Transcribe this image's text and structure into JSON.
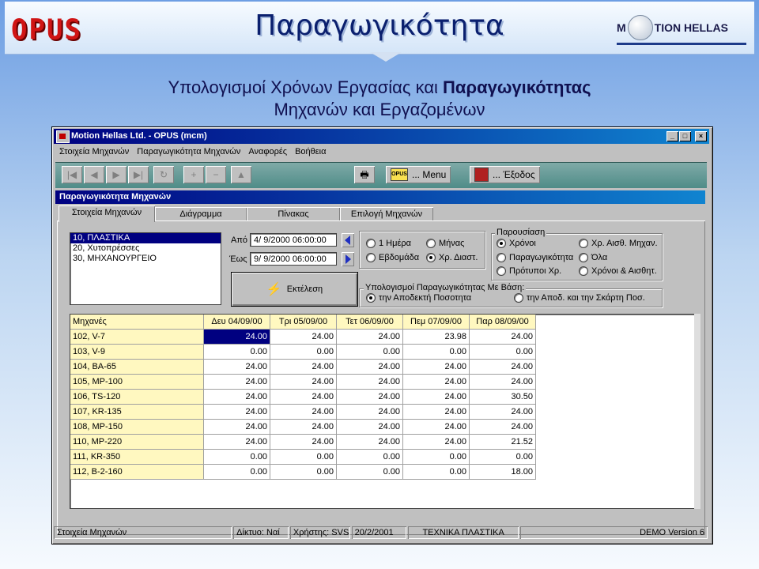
{
  "slide": {
    "logo_left": "OPUS",
    "title": "Παραγωγικότητα",
    "logo_right_a": "M",
    "logo_right_b": "TION HELLAS",
    "subtitle_line1_a": "Υπολογισμοί Χρόνων Εργασίας και ",
    "subtitle_line1_b": "Παραγωγικότητας",
    "subtitle_line2": "Μηχανών και Εργαζομένων"
  },
  "window": {
    "title": "Motion Hellas Ltd. - OPUS (mcm)",
    "controls": [
      "_",
      "□",
      "×"
    ],
    "menu": [
      "Στοιχεία Μηχανών",
      "Παραγωγικότητα Μηχανών",
      "Αναφορές",
      "Βοήθεια"
    ],
    "toolbar": {
      "nav_icons": [
        "first-icon",
        "prev-icon",
        "next-icon",
        "last-icon",
        "refresh-icon",
        "add-icon",
        "delete-icon",
        "post-icon"
      ],
      "nav_glyphs": [
        "|◀",
        "◀",
        "▶",
        "▶|",
        "↻",
        "+",
        "−",
        "▲"
      ],
      "print_glyph": "🖶",
      "menu_icon_text": "OPUS",
      "menu_label": "... Menu",
      "exit_label": "... Έξοδος"
    },
    "form_title": "Παραγωγικότητα Μηχανών",
    "tabs": [
      "Στοιχεία Μηχανών",
      "Διάγραμμα",
      "Πίνακας",
      "Επιλογή Μηχανών"
    ],
    "groups": [
      "10, ΠΛΑΣΤΙΚΑ",
      "20, Χυτοπρέσσες",
      "30, ΜΗΧΑΝΟΥΡΓΕΙΟ"
    ],
    "from_label": "Από",
    "to_label": "Έως",
    "from_value": "4/ 9/2000 06:00:00",
    "to_value": "9/ 9/2000 06:00:00",
    "execute_label": "Εκτέλεση",
    "period_options": [
      "1 Ημέρα",
      "Μήνας",
      "Εβδομάδα",
      "Χρ. Διαστ."
    ],
    "presentation_title": "Παρουσίαση",
    "presentation_options": [
      "Χρόνοι",
      "Χρ. Αισθ. Μηχαν.",
      "Παραγωγικότητα",
      "Όλα",
      "Πρότυποι Χρ.",
      "Χρόνοι & Αισθητ."
    ],
    "basis_title": "Υπολογισμοί Παραγωγικότητας Με Βάση:",
    "basis_options": [
      "την Αποδεκτή Ποσοτητα",
      "την Αποδ. και την Σκάρτη Ποσ."
    ],
    "grid": {
      "headers": [
        "Μηχανές",
        "Δευ 04/09/00",
        "Τρι 05/09/00",
        "Τετ 06/09/00",
        "Πεμ 07/09/00",
        "Παρ 08/09/00"
      ],
      "rows": [
        [
          "102, V-7",
          "24.00",
          "24.00",
          "24.00",
          "23.98",
          "24.00"
        ],
        [
          "103, V-9",
          "0.00",
          "0.00",
          "0.00",
          "0.00",
          "0.00"
        ],
        [
          "104, ΒΑ-65",
          "24.00",
          "24.00",
          "24.00",
          "24.00",
          "24.00"
        ],
        [
          "105, ΜΡ-100",
          "24.00",
          "24.00",
          "24.00",
          "24.00",
          "24.00"
        ],
        [
          "106, TS-120",
          "24.00",
          "24.00",
          "24.00",
          "24.00",
          "30.50"
        ],
        [
          "107, KR-135",
          "24.00",
          "24.00",
          "24.00",
          "24.00",
          "24.00"
        ],
        [
          "108, ΜΡ-150",
          "24.00",
          "24.00",
          "24.00",
          "24.00",
          "24.00"
        ],
        [
          "110, ΜΡ-220",
          "24.00",
          "24.00",
          "24.00",
          "24.00",
          "21.52"
        ],
        [
          "111, KR-350",
          "0.00",
          "0.00",
          "0.00",
          "0.00",
          "0.00"
        ],
        [
          "112, Β-2-160",
          "0.00",
          "0.00",
          "0.00",
          "0.00",
          "18.00"
        ]
      ]
    },
    "status": [
      "Στοιχεία Μηχανών",
      "Δίκτυο: Ναί",
      "Χρήστης: SVS",
      "20/2/2001",
      "ΤΕΧΝΙΚΑ ΠΛΑΣΤΙΚΑ",
      "DEMO Version 6"
    ]
  }
}
